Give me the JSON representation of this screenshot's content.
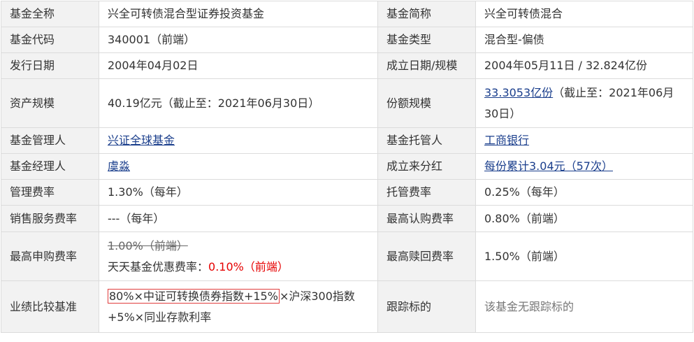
{
  "rows": [
    {
      "l1": "基金全称",
      "v1": "兴全可转债混合型证券投资基金",
      "l2": "基金简称",
      "v2": "兴全可转债混合"
    },
    {
      "l1": "基金代码",
      "v1": "340001（前端）",
      "l2": "基金类型",
      "v2": "混合型-偏债"
    },
    {
      "l1": "发行日期",
      "v1": "2004年04月02日",
      "l2": "成立日期/规模",
      "v2": "2004年05月11日 / 32.824亿份"
    },
    {
      "l1": "资产规模",
      "v1": "40.19亿元（截止至：2021年06月30日）",
      "l2": "份额规模",
      "v2_link": "33.3053亿份",
      "v2_rest": "（截止至：2021年06月30日）"
    },
    {
      "l1": "基金管理人",
      "v1_link": "兴证全球基金",
      "l2": "基金托管人",
      "v2_link": "工商银行"
    },
    {
      "l1": "基金经理人",
      "v1_link": "虞淼",
      "l2": "成立来分红",
      "v2_link": "每份累计3.04元（57次）"
    },
    {
      "l1": "管理费率",
      "v1": "1.30%（每年）",
      "l2": "托管费率",
      "v2": "0.25%（每年）"
    },
    {
      "l1": "销售服务费率",
      "v1": "---（每年）",
      "l2": "最高认购费率",
      "v2": "0.80%（前端）"
    },
    {
      "l1": "最高申购费率",
      "v1_strike": "1.00%（前端）",
      "v1_discount_label": "天天基金优惠费率：",
      "v1_discount_value": "0.10%（前端）",
      "l2": "最高赎回费率",
      "v2": "1.50%（前端）"
    },
    {
      "l1": "业绩比较基准",
      "v1_boxed": "80%×中证可转换债券指数+15%",
      "v1_rest": "×沪深300指数+5%×同业存款利率",
      "l2": "跟踪标的",
      "v2": "该基金无跟踪标的"
    }
  ]
}
